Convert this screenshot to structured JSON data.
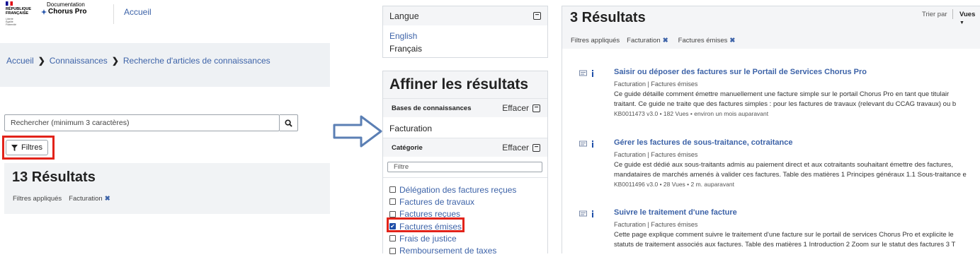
{
  "header": {
    "rf_logo": [
      "RÉPUBLIQUE",
      "FRANÇAISE"
    ],
    "rf_motto": [
      "Liberté",
      "Égalité",
      "Fraternité"
    ],
    "doc_label": "Documentation",
    "product_name": "Chorus Pro",
    "home_link": "Accueil"
  },
  "breadcrumb": [
    "Accueil",
    "Connaissances",
    "Recherche d'articles de connaissances"
  ],
  "search": {
    "placeholder": "Rechercher (minimum 3 caractères)"
  },
  "filters_button": "Filtres",
  "left_results": {
    "title": "13 Résultats",
    "applied_label": "Filtres appliqués",
    "applied": [
      "Facturation"
    ]
  },
  "language_panel": {
    "title": "Langue",
    "options": [
      {
        "label": "English",
        "selected": false
      },
      {
        "label": "Français",
        "selected": true
      }
    ]
  },
  "refine": {
    "title": "Affiner les résultats",
    "clear_label": "Effacer",
    "kb_section": {
      "label": "Bases de connaissances",
      "value": "Facturation"
    },
    "category_section": {
      "label": "Catégorie",
      "filter_placeholder": "Filtre",
      "items": [
        {
          "label": "Délégation des factures reçues",
          "checked": false
        },
        {
          "label": "Factures de travaux",
          "checked": false
        },
        {
          "label": "Factures reçues",
          "checked": false
        },
        {
          "label": "Factures émises",
          "checked": true
        },
        {
          "label": "Frais de justice",
          "checked": false
        },
        {
          "label": "Remboursement de taxes",
          "checked": false
        }
      ]
    }
  },
  "right_results": {
    "title": "3 Résultats",
    "sort_label": "Trier par",
    "views_label": "Vues",
    "applied_label": "Filtres appliqués",
    "applied": [
      "Facturation",
      "Factures émises"
    ],
    "articles": [
      {
        "title": "Saisir ou déposer des factures sur le Portail de Services Chorus Pro",
        "meta": "Facturation | Factures émises",
        "desc": [
          "Ce guide détaille comment émettre manuellement une facture simple sur le portail Chorus Pro en tant que titulair",
          "traitant. Ce guide ne traite que des factures simples : pour les factures de travaux (relevant du CCAG travaux) ou b"
        ],
        "info": "KB0011473 v3.0  •  182 Vues  •  environ un mois auparavant"
      },
      {
        "title": "Gérer les factures de sous-traitance, cotraitance",
        "meta": "Facturation | Factures émises",
        "desc": [
          "Ce guide est dédié aux sous-traitants admis au paiement direct et aux cotraitants souhaitant émettre des factures,",
          "mandataires de marchés amenés à valider ces factures. Table des matières 1 Principes généraux 1.1 Sous-traitance e"
        ],
        "info": "KB0011496 v3.0  •  28 Vues  •  2 m. auparavant"
      },
      {
        "title": "Suivre le traitement d'une facture",
        "meta": "Facturation | Factures émises",
        "desc": [
          "Cette page explique comment suivre le traitement d'une facture sur le portail de services Chorus Pro et explicite le",
          "statuts de traitement associés aux factures. Table des matières 1 Introduction 2 Zoom sur le statut des factures 3 T"
        ],
        "info": ""
      }
    ]
  },
  "colors": {
    "link": "#3d63a8",
    "highlight": "#e2231a",
    "panel_bg": "#f4f5f7",
    "arrow": "#5b7fb4"
  },
  "icons": [
    "search-icon",
    "filter-icon",
    "close-icon",
    "collapse-icon",
    "article-icon",
    "chevron-right-icon",
    "chevron-down-icon",
    "arrow-right-icon"
  ]
}
